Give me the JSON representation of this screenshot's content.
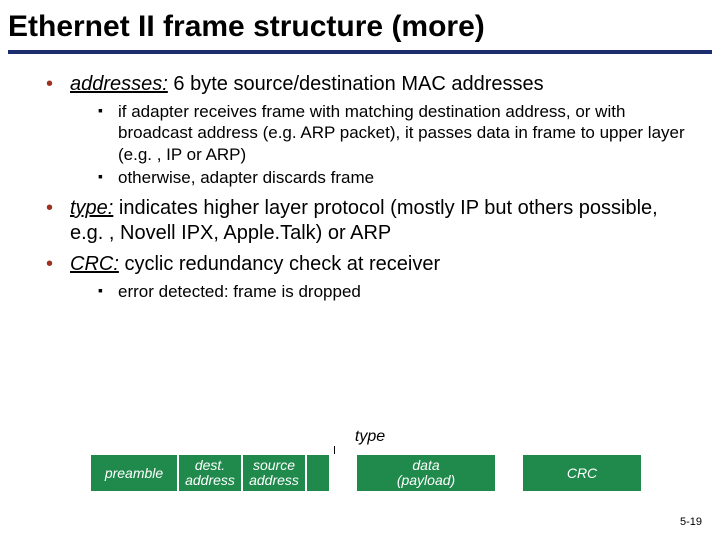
{
  "title": "Ethernet II frame structure (more)",
  "bullets": {
    "addresses": {
      "lead": "addresses:",
      "text": " 6 byte source/destination MAC addresses",
      "sub": [
        "if adapter receives frame with matching destination address, or with broadcast address (e.g. ARP packet), it passes data in frame to upper layer (e.g. , IP or ARP)",
        "otherwise, adapter discards frame"
      ]
    },
    "type": {
      "lead": "type:",
      "text": " indicates higher layer protocol (mostly IP but others possible, e.g. , Novell IPX, Apple.Talk) or ARP"
    },
    "crc": {
      "lead": "CRC:",
      "text": " cyclic redundancy check at receiver",
      "sub": [
        "error detected: frame is dropped"
      ]
    }
  },
  "diagram": {
    "type_label": "type",
    "cells": {
      "preamble": "preamble",
      "dest": "dest.\naddress",
      "src": "source\naddress",
      "data": "data\n(payload)",
      "crc": "CRC"
    }
  },
  "pagenum": "5-19"
}
